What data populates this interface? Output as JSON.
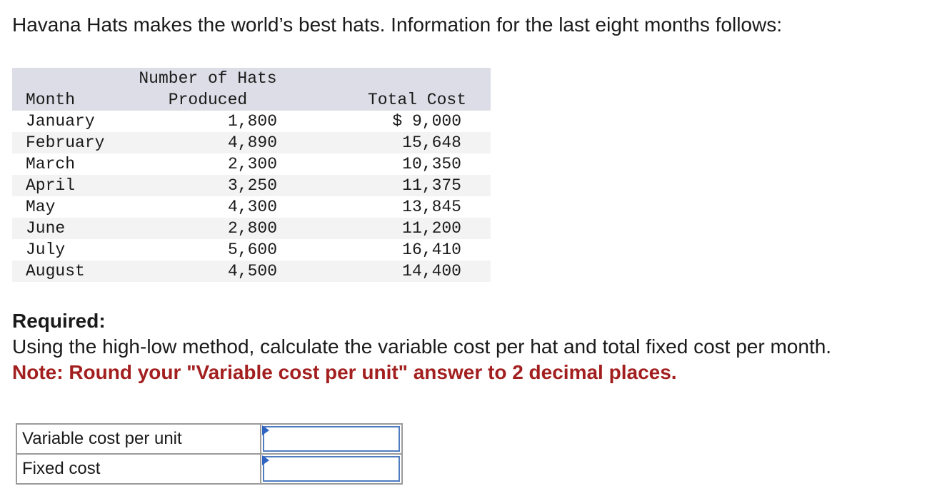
{
  "intro": "Havana Hats makes the world’s best hats. Information for the last eight months follows:",
  "table": {
    "headers": {
      "month": "Month",
      "hats_line1": "Number of Hats",
      "hats_line2": "Produced",
      "cost": "Total Cost"
    },
    "rows": [
      {
        "month": "January",
        "hats": "1,800",
        "cost": "$ 9,000"
      },
      {
        "month": "February",
        "hats": "4,890",
        "cost": "15,648"
      },
      {
        "month": "March",
        "hats": "2,300",
        "cost": "10,350"
      },
      {
        "month": "April",
        "hats": "3,250",
        "cost": "11,375"
      },
      {
        "month": "May",
        "hats": "4,300",
        "cost": "13,845"
      },
      {
        "month": "June",
        "hats": "2,800",
        "cost": "11,200"
      },
      {
        "month": "July",
        "hats": "5,600",
        "cost": "16,410"
      },
      {
        "month": "August",
        "hats": "4,500",
        "cost": "14,400"
      }
    ]
  },
  "required": {
    "title": "Required:",
    "text": "Using the high-low method, calculate the variable cost per hat and total fixed cost per month.",
    "note": "Note: Round your \"Variable cost per unit\" answer to 2 decimal places."
  },
  "answers": [
    {
      "label": "Variable cost per unit",
      "value": ""
    },
    {
      "label": "Fixed cost",
      "value": ""
    }
  ],
  "colors": {
    "note_red": "#a31f1f",
    "header_bg": "#dcdde6",
    "input_border": "#4f7cc0"
  }
}
